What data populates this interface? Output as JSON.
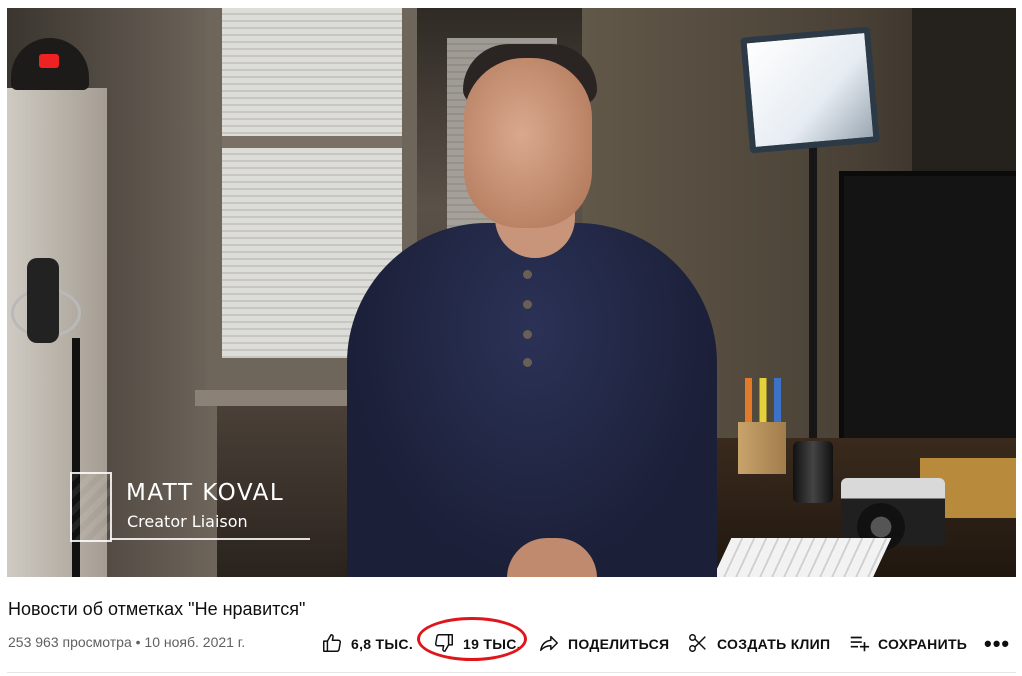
{
  "video": {
    "overlay_name": "MATT KOVAL",
    "overlay_role": "Creator Liaison"
  },
  "info": {
    "title": "Новости об отметках \"Не нравится\"",
    "meta": "253 963 просмотра • 10 нояб. 2021 г."
  },
  "actions": {
    "like_count": "6,8 ТЫС.",
    "dislike_count": "19 ТЫС.",
    "share_label": "ПОДЕЛИТЬСЯ",
    "clip_label": "СОЗДАТЬ КЛИП",
    "save_label": "СОХРАНИТЬ",
    "more_label": "•••"
  },
  "colors": {
    "annotation_ring": "#e0141b",
    "text_primary": "#0f0f0f",
    "text_secondary": "#606060"
  },
  "icons": [
    "thumb-up-icon",
    "thumb-down-icon",
    "share-arrow-icon",
    "scissors-icon",
    "playlist-add-icon",
    "more-icon"
  ]
}
